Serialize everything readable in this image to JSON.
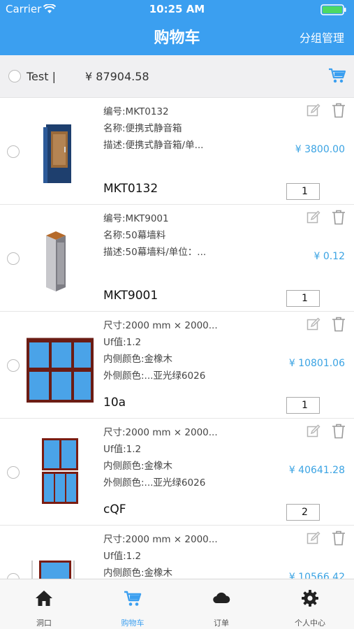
{
  "status_bar": {
    "carrier": "Carrier",
    "time": "10:25 AM"
  },
  "nav": {
    "title": "购物车",
    "right_action": "分组管理"
  },
  "group": {
    "name": "Test |",
    "total": "¥ 87904.58"
  },
  "items": [
    {
      "lines": [
        "编号:MKT0132",
        "名称:便携式静音箱",
        "描述:便携式静音箱/单..."
      ],
      "name": "MKT0132",
      "price": "¥ 3800.00",
      "qty": "1"
    },
    {
      "lines": [
        "编号:MKT9001",
        "名称:50幕墙料",
        "描述:50幕墙料/单位：..."
      ],
      "name": "MKT9001",
      "price": "¥ 0.12",
      "qty": "1"
    },
    {
      "lines": [
        "尺寸:2000 mm × 2000...",
        "Uf值:1.2",
        "内侧颜色:金橡木",
        "外侧颜色:...亚光绿6026"
      ],
      "name": "10a",
      "price": "¥ 10801.06",
      "qty": "1"
    },
    {
      "lines": [
        "尺寸:2000 mm × 2000...",
        "Uf值:1.2",
        "内侧颜色:金橡木",
        "外侧颜色:...亚光绿6026"
      ],
      "name": "cQF",
      "price": "¥ 40641.28",
      "qty": "2"
    },
    {
      "lines": [
        "尺寸:2000 mm × 2000...",
        "Uf值:1.2",
        "内侧颜色:金橡木"
      ],
      "name": "",
      "price": "¥ 10566.42",
      "qty": ""
    }
  ],
  "tabs": [
    {
      "label": "洞口",
      "icon": "home-icon"
    },
    {
      "label": "购物车",
      "icon": "cart-icon",
      "active": true
    },
    {
      "label": "订单",
      "icon": "cloud-icon"
    },
    {
      "label": "个人中心",
      "icon": "gear-icon"
    }
  ],
  "colors": {
    "primary": "#3b9ff0",
    "price": "#3aa3e3"
  }
}
